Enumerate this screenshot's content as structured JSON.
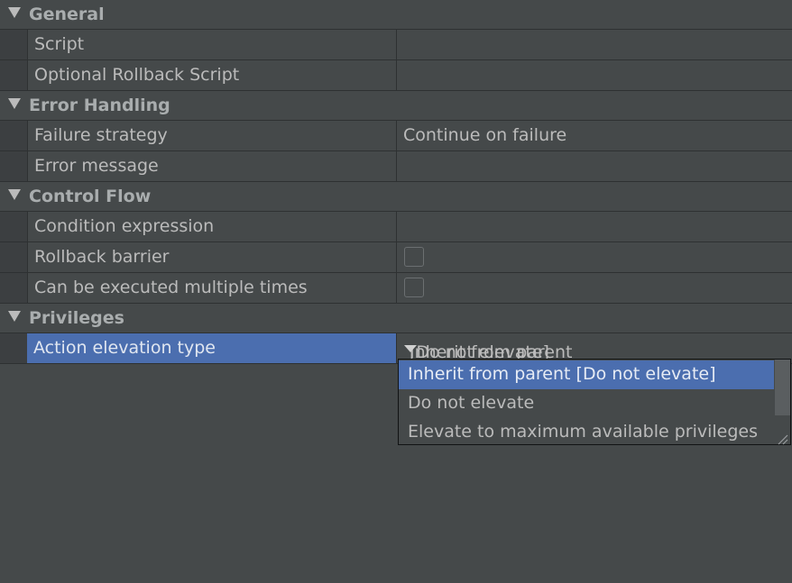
{
  "sections": [
    {
      "title": "General",
      "rows": [
        {
          "name": "Script",
          "value": ""
        },
        {
          "name": "Optional Rollback Script",
          "value": ""
        }
      ]
    },
    {
      "title": "Error Handling",
      "rows": [
        {
          "name": "Failure strategy",
          "value": "Continue on failure"
        },
        {
          "name": "Error message",
          "value": ""
        }
      ]
    },
    {
      "title": "Control Flow",
      "rows": [
        {
          "name": "Condition expression",
          "value": ""
        },
        {
          "name": "Rollback barrier",
          "checked": false
        },
        {
          "name": "Can be executed multiple times",
          "checked": false
        }
      ]
    },
    {
      "title": "Privileges",
      "rows": [
        {
          "name": "Action elevation type",
          "combo_main": "Inherit from parent",
          "combo_hint": "[Do not elevate]"
        }
      ]
    }
  ],
  "dropdown": {
    "options": [
      "Inherit from parent [Do not elevate]",
      "Do not elevate",
      "Elevate to maximum available privileges"
    ],
    "highlighted_index": 0
  },
  "colors": {
    "background": "#45494a",
    "selection": "#4b6eaf",
    "text": "#bbbbbb"
  }
}
